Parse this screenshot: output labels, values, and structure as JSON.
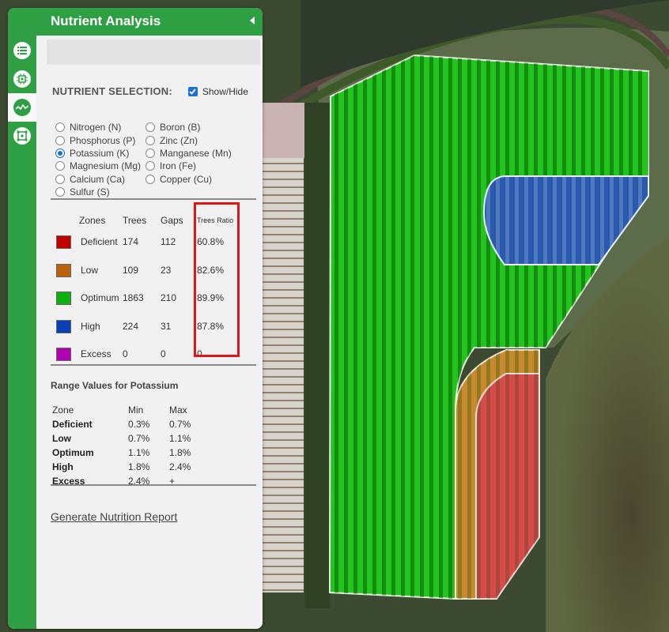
{
  "panel": {
    "title": "Nutrient Analysis",
    "collapse_icon": "caret-left-icon",
    "sidebar": [
      {
        "icon": "list-icon",
        "active": false
      },
      {
        "icon": "chip-icon",
        "active": false
      },
      {
        "icon": "wave-chart-icon",
        "active": true
      },
      {
        "icon": "boundary-icon",
        "active": false
      }
    ],
    "search_bar_value": ""
  },
  "nutrient_selection": {
    "label": "NUTRIENT SELECTION:",
    "show_hide_label": "Show/Hide",
    "show_hide_checked": true,
    "left_options": [
      "Nitrogen (N)",
      "Phosphorus (P)",
      "Potassium (K)",
      "Magnesium (Mg)",
      "Calcium (Ca)",
      "Sulfur (S)"
    ],
    "right_options": [
      "Boron (B)",
      "Zinc (Zn)",
      "Manganese (Mn)",
      "Iron (Fe)",
      "Copper (Cu)"
    ],
    "selected": "Potassium (K)"
  },
  "zones_table": {
    "headers": [
      "Zones",
      "Trees",
      "Gaps",
      "Trees Ratio"
    ],
    "rows": [
      {
        "zone": "Deficient",
        "trees": "174",
        "gaps": "112",
        "ratio": "60.8%",
        "color": "#c00000"
      },
      {
        "zone": "Low",
        "trees": "109",
        "gaps": "23",
        "ratio": "82.6%",
        "color": "#b8620f"
      },
      {
        "zone": "Optimum",
        "trees": "1863",
        "gaps": "210",
        "ratio": "89.9%",
        "color": "#10b010"
      },
      {
        "zone": "High",
        "trees": "224",
        "gaps": "31",
        "ratio": "87.8%",
        "color": "#0a3fb5"
      },
      {
        "zone": "Excess",
        "trees": "0",
        "gaps": "0",
        "ratio": "0",
        "color": "#b000b0"
      }
    ]
  },
  "range_values": {
    "title": "Range Values for Potassium",
    "headers": [
      "Zone",
      "Min",
      "Max"
    ],
    "rows": [
      {
        "zone": "Deficient",
        "min": "0.3%",
        "max": "0.7%"
      },
      {
        "zone": "Low",
        "min": "0.7%",
        "max": "1.1%"
      },
      {
        "zone": "Optimum",
        "min": "1.1%",
        "max": "1.8%"
      },
      {
        "zone": "High",
        "min": "1.8%",
        "max": "2.4%"
      },
      {
        "zone": "Excess",
        "min": "2.4%",
        "max": "+"
      }
    ]
  },
  "report_link": "Generate Nutrition Report",
  "map": {
    "zone_colors": {
      "optimum": "#22c41e",
      "high": "#2a5aad",
      "low": "#c88a2c",
      "deficient": "#d94a4a"
    }
  }
}
